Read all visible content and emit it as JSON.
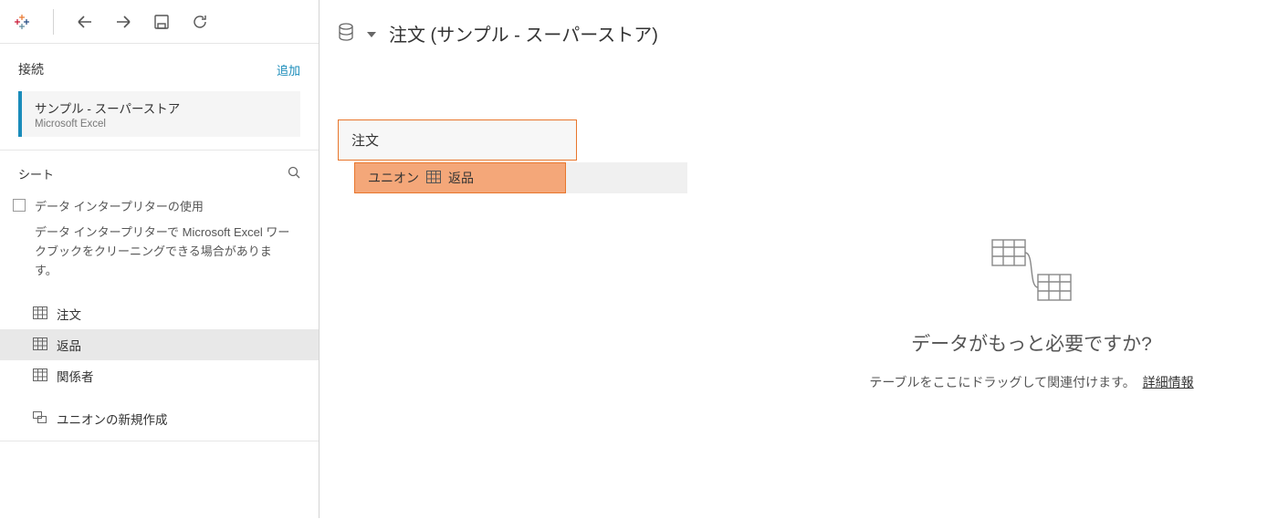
{
  "toolbar": {
    "logo_name": "tableau-logo"
  },
  "sidebar": {
    "connections_header": "接続",
    "add_label": "追加",
    "connection": {
      "name": "サンプル - スーパーストア",
      "type": "Microsoft Excel"
    },
    "sheets_header": "シート",
    "interpreter": {
      "label": "データ インタープリターの使用",
      "desc": "データ インタープリターで Microsoft Excel ワークブックをクリーニングできる場合があります。"
    },
    "sheets": [
      {
        "label": "注文",
        "selected": false
      },
      {
        "label": "返品",
        "selected": true
      },
      {
        "label": "関係者",
        "selected": false
      }
    ],
    "new_union_label": "ユニオンの新規作成"
  },
  "main": {
    "title": "注文 (サンプル - スーパーストア)",
    "table_box_label": "注文",
    "union_drop": {
      "union_label": "ユニオン",
      "dragging_label": "返品"
    },
    "placeholder": {
      "heading": "データがもっと必要ですか?",
      "sub": "テーブルをここにドラッグして関連付けます。",
      "link": "詳細情報"
    }
  }
}
